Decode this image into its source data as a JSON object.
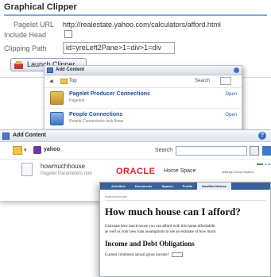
{
  "clipper": {
    "title": "Graphical Clipper",
    "pagelet_url_label": "Pagelet URL",
    "pagelet_url_value": "http://realestate.yahoo.com/calculators/afford.html",
    "include_head_label": "Include Head",
    "include_head_checked": false,
    "clipping_path_label": "Clipping Path",
    "clipping_path_value": "id=yreLeft2Pane>1=div>1=div",
    "launch_button": "Launch Clipper"
  },
  "add_content_small": {
    "title": "Add Content",
    "crumb": "Top",
    "search_label": "Search",
    "items": [
      {
        "name": "Pagelet Producer Connections",
        "sub": "Pagelets",
        "action": "Open"
      },
      {
        "name": "People Connections",
        "sub": "People Connections task flows",
        "action": "Open"
      }
    ]
  },
  "add_content_large": {
    "title": "Add Content",
    "crumb": "yahoo",
    "search_label": "Search",
    "item_name": "howmuchhouse",
    "item_sub": "Pagelet Parameters:non",
    "add_label": "Ad"
  },
  "oracle_strip": {
    "logo": "ORACLE",
    "home_space": "Home Space",
    "links": "settings   Group Spaces"
  },
  "calculator": {
    "tabs": [
      "Activities",
      "Documents",
      "Spaces",
      "Profile",
      "HowMuchHouse"
    ],
    "active_tab": 4,
    "crumb": "howmuchhouse",
    "heading": "How much house can I afford?",
    "paragraph_line1": "Calculate how much house you can afford with this home affordabilit",
    "paragraph_line2": "as well as your new loan assumptions to see an estimate of how much",
    "subheading": "Income and Debt Obligations",
    "field_label": "Current combined annual gross income?"
  },
  "colors": {
    "accent_blue": "#214a93",
    "oracle_red": "#e31b23",
    "tab_bar": "#3b5f98"
  }
}
